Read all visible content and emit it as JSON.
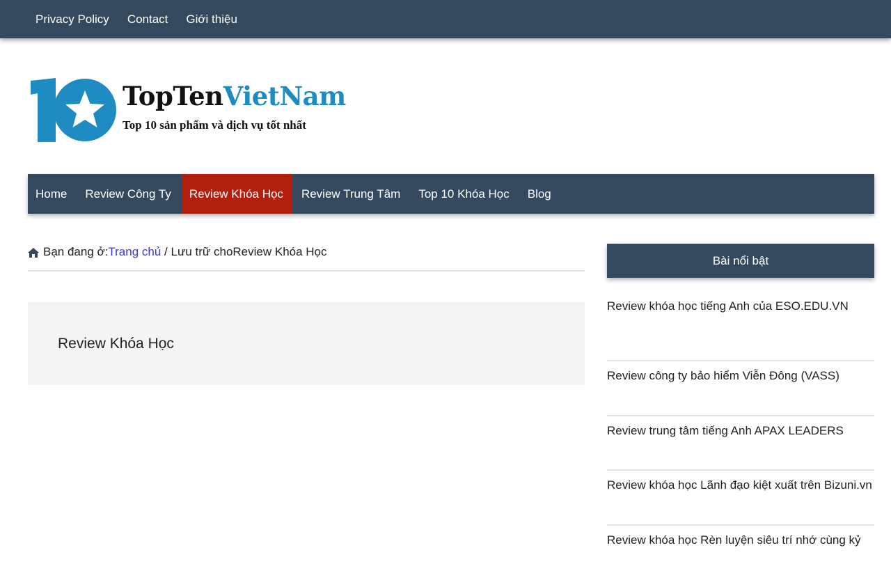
{
  "topbar": {
    "links": [
      "Privacy Policy",
      "Contact",
      "Giới thiệu"
    ]
  },
  "logo": {
    "title_part1": "TopTen",
    "title_part2": "VietNam",
    "subtitle": "Top 10 sản phẩm và dịch vụ tốt nhất",
    "emblem_icon": "number-10-star-icon",
    "colors": {
      "blue": "#1e8bc3",
      "dark": "#111111"
    }
  },
  "mainnav": {
    "items": [
      "Home",
      "Review Công Ty",
      "Review Khóa Học",
      "Review Trung Tâm",
      "Top 10 Khóa Học",
      "Blog"
    ],
    "active": "Review Khóa Học",
    "colors": {
      "bg": "#34495e",
      "active_bg": "#b1200f"
    }
  },
  "breadcrumb": {
    "icon": "home-icon",
    "prefix": "Bạn đang ở:",
    "home_link": "Trang chủ",
    "separator": " / ",
    "current": "Lưu trữ choReview Khóa Học"
  },
  "archive": {
    "title": "Review Khóa Học"
  },
  "sidebar": {
    "title": "Bài nổi bật",
    "posts": [
      "Review khóa học tiếng Anh của ESO.EDU.VN",
      "Review công ty bảo hiểm Viễn Đông (VASS)",
      "Review trung tâm tiếng Anh APAX LEADERS",
      "Review khóa học Lãnh đạo kiệt xuất trên Bizuni.vn",
      "Review khóa học Rèn luyện siêu trí nhớ cùng kỷ"
    ]
  }
}
